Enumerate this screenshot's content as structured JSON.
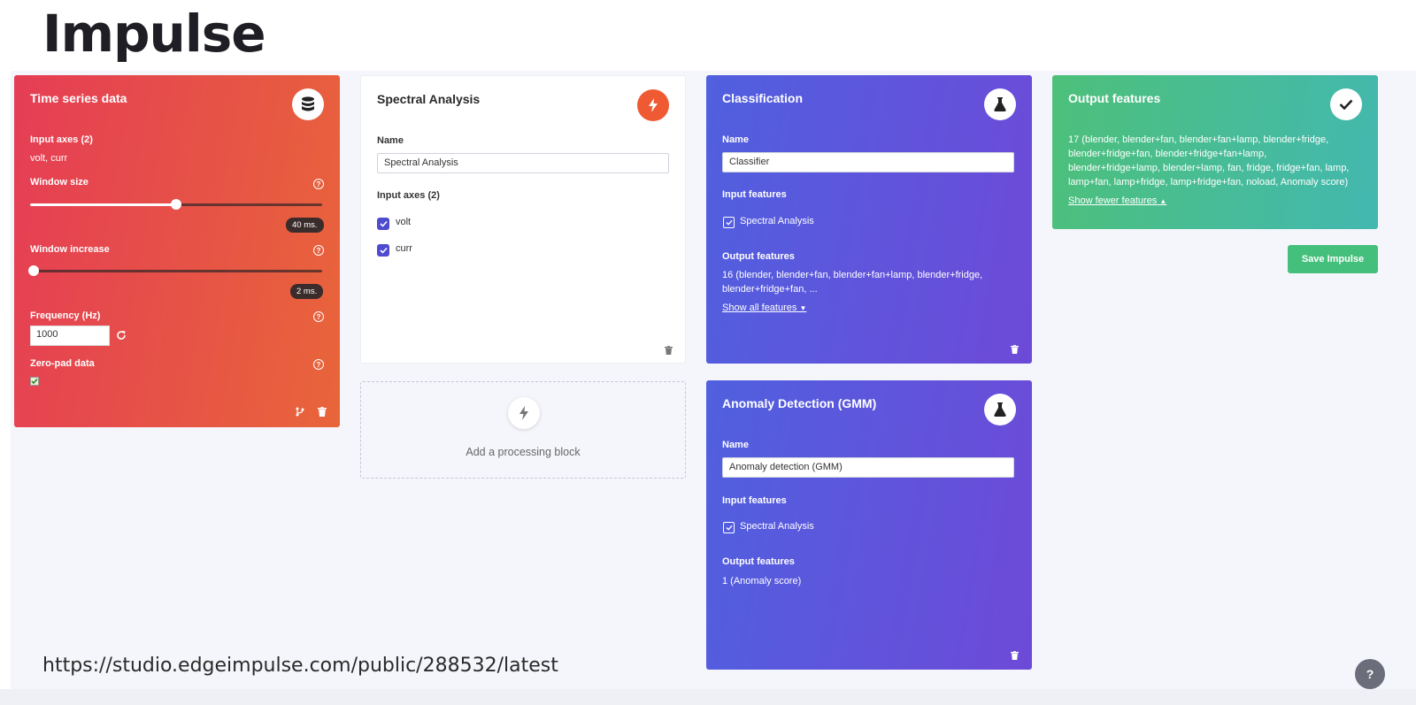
{
  "page": {
    "title": "Impulse",
    "url": "https://studio.edgeimpulse.com/public/288532/latest"
  },
  "time_series": {
    "title": "Time series data",
    "input_axes_label": "Input axes (2)",
    "input_axes_value": "volt, curr",
    "window_size_label": "Window size",
    "window_size_value": "40 ms.",
    "window_size_fraction": 0.5,
    "window_increase_label": "Window increase",
    "window_increase_value": "2 ms.",
    "window_increase_fraction": 0.0,
    "frequency_label": "Frequency (Hz)",
    "frequency_value": "1000",
    "zero_pad_label": "Zero-pad data",
    "zero_pad_checked": true
  },
  "spectral": {
    "title": "Spectral Analysis",
    "name_label": "Name",
    "name_value": "Spectral Analysis",
    "input_axes_label": "Input axes (2)",
    "axes": [
      "volt",
      "curr"
    ]
  },
  "add_block": {
    "label": "Add a processing block"
  },
  "classification": {
    "title": "Classification",
    "name_label": "Name",
    "name_value": "Classifier",
    "input_features_label": "Input features",
    "input_feature": "Spectral Analysis",
    "output_features_label": "Output features",
    "output_features_line1": "16 (blender, blender+fan, blender+fan+lamp, blender+fridge,",
    "output_features_line2": "blender+fridge+fan, ...",
    "show_all_link": "Show all features"
  },
  "anomaly": {
    "title": "Anomaly Detection (GMM)",
    "name_label": "Name",
    "name_value": "Anomaly detection (GMM)",
    "input_features_label": "Input features",
    "input_feature": "Spectral Analysis",
    "output_features_label": "Output features",
    "output_features_value": "1 (Anomaly score)"
  },
  "output": {
    "title": "Output features",
    "line1": "17 (blender, blender+fan, blender+fan+lamp, blender+fridge,",
    "line2": "blender+fridge+fan, blender+fridge+fan+lamp,",
    "line3": "blender+fridge+lamp, blender+lamp, fan, fridge, fridge+fan, lamp,",
    "line4": "lamp+fan, lamp+fridge, lamp+fridge+fan, noload, Anomaly score)",
    "show_fewer_link": "Show fewer features"
  },
  "save_button": {
    "label": "Save Impulse"
  },
  "colors": {
    "ts": "#e53d55",
    "spectral_icon": "#ef5a33",
    "purple": "#5a55dc",
    "green": "#46bf86"
  }
}
